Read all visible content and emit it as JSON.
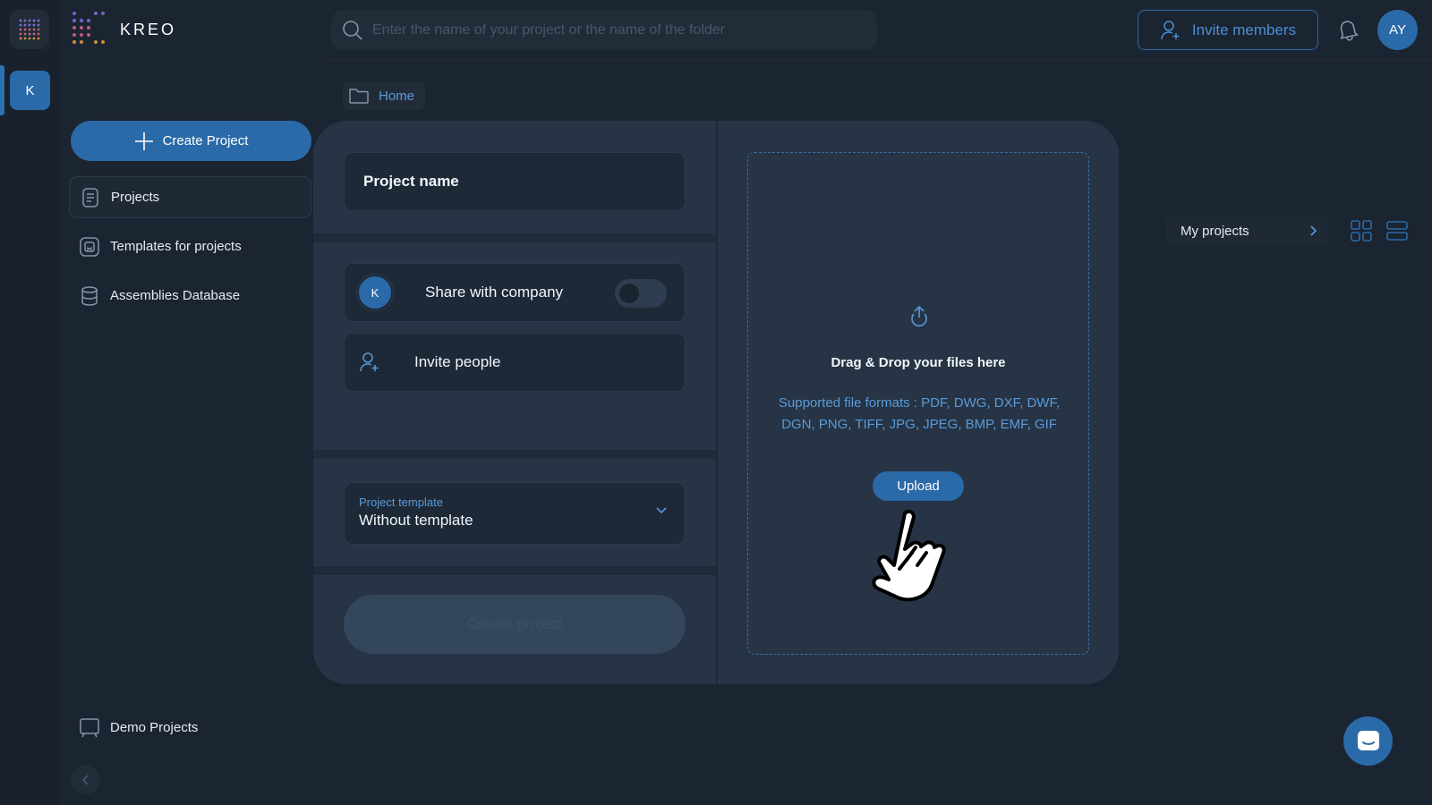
{
  "rail": {
    "company_initial": "K"
  },
  "brand": {
    "name": "KREO"
  },
  "sidebar": {
    "create_label": "Create Project",
    "items": [
      {
        "label": "Projects",
        "icon": "projects-icon",
        "active": true
      },
      {
        "label": "Templates for projects",
        "icon": "templates-icon",
        "active": false
      },
      {
        "label": "Assemblies Database",
        "icon": "database-icon",
        "active": false
      }
    ],
    "demo_label": "Demo Projects"
  },
  "header": {
    "search_placeholder": "Enter the name of your project or the name of the folder",
    "invite_label": "Invite members",
    "avatar_initials": "AY"
  },
  "breadcrumb": {
    "home_label": "Home"
  },
  "projects_view": {
    "filter_label": "My projects"
  },
  "modal": {
    "project_name_placeholder": "Project name",
    "share_initial": "K",
    "share_label": "Share with company",
    "share_enabled": false,
    "invite_label": "Invite people",
    "template_label": "Project template",
    "template_value": "Without template",
    "create_label": "Create project",
    "drop_title": "Drag & Drop your files here",
    "drop_formats": "Supported file formats : PDF, DWG, DXF, DWF, DGN, PNG, TIFF, JPG, JPEG, BMP, EMF, GIF",
    "upload_label": "Upload"
  },
  "colors": {
    "accent": "#2b6aa8",
    "link": "#5a9ad8",
    "background": "#1b2431",
    "panel": "#263445"
  }
}
